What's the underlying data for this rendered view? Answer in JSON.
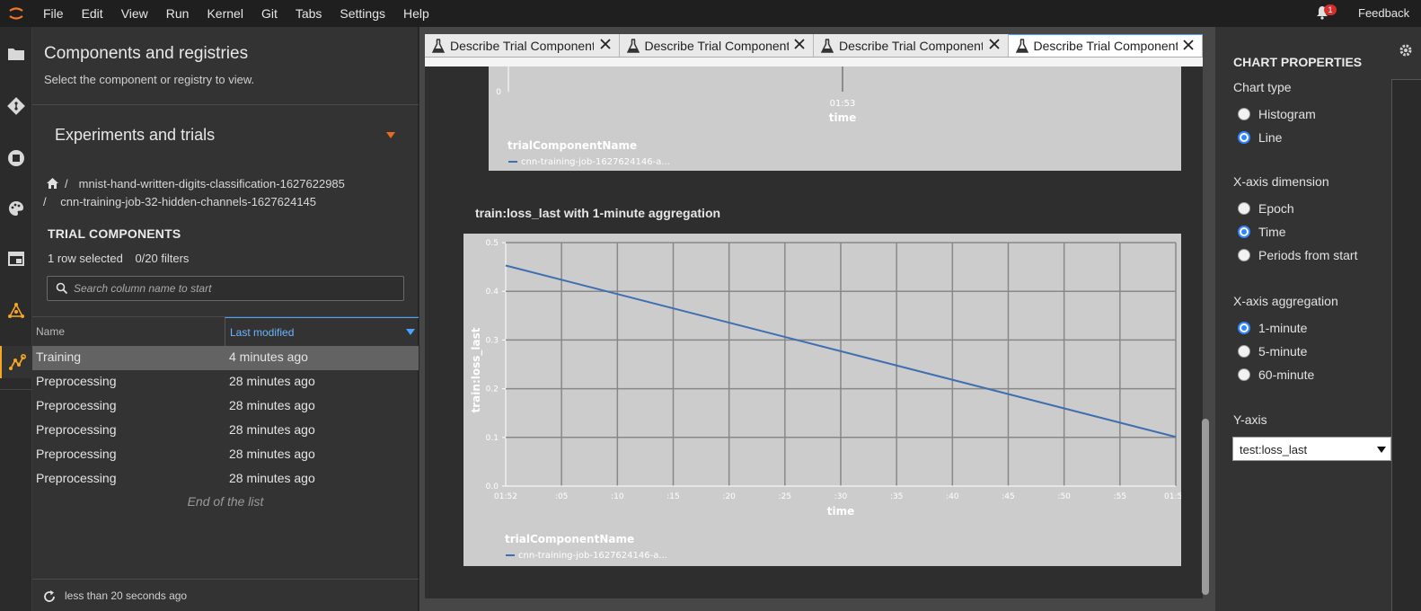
{
  "menubar": {
    "items": [
      "File",
      "Edit",
      "View",
      "Run",
      "Kernel",
      "Git",
      "Tabs",
      "Settings",
      "Help"
    ],
    "notification_count": "1",
    "feedback_label": "Feedback"
  },
  "left_panel": {
    "title": "Components and registries",
    "subtitle": "Select the component or registry to view.",
    "section_title": "Experiments and trials",
    "breadcrumb": {
      "experiment": "mnist-hand-written-digits-classification-1627622985",
      "trial": "cnn-training-job-32-hidden-channels-1627624145"
    },
    "trial_components_title": "TRIAL COMPONENTS",
    "selection_info": "1 row selected",
    "filter_info": "0/20 filters",
    "search_placeholder": "Search column name to start",
    "columns": [
      "Name",
      "Last modified"
    ],
    "rows": [
      {
        "name": "Training",
        "modified": "4 minutes ago",
        "selected": true
      },
      {
        "name": "Preprocessing",
        "modified": "28 minutes ago",
        "selected": false
      },
      {
        "name": "Preprocessing",
        "modified": "28 minutes ago",
        "selected": false
      },
      {
        "name": "Preprocessing",
        "modified": "28 minutes ago",
        "selected": false
      },
      {
        "name": "Preprocessing",
        "modified": "28 minutes ago",
        "selected": false
      },
      {
        "name": "Preprocessing",
        "modified": "28 minutes ago",
        "selected": false
      }
    ],
    "end_of_list": "End of the list",
    "footer_status": "less than 20 seconds ago"
  },
  "tabs": [
    {
      "label": "Describe Trial Component",
      "active": false
    },
    {
      "label": "Describe Trial Component",
      "active": false
    },
    {
      "label": "Describe Trial Component",
      "active": false
    },
    {
      "label": "Describe Trial Component",
      "active": true
    }
  ],
  "top_chart": {
    "y_tick": "0",
    "x_tick": "01:53",
    "x_label": "time",
    "legend_title": "trialComponentName",
    "legend_entry": "cnn-training-job-1627624146-a..."
  },
  "chart_title": "train:loss_last with 1-minute aggregation",
  "chart_data": {
    "type": "line",
    "title": "train:loss_last with 1-minute aggregation",
    "xlabel": "time",
    "ylabel": "train:loss_last",
    "x_ticks": [
      "01:52",
      ":05",
      ":10",
      ":15",
      ":20",
      ":25",
      ":30",
      ":35",
      ":40",
      ":45",
      ":50",
      ":55",
      "01:53"
    ],
    "y_ticks": [
      "0.0",
      "0.1",
      "0.2",
      "0.3",
      "0.4",
      "0.5"
    ],
    "ylim": [
      0,
      0.5
    ],
    "xlim_seconds": [
      0,
      60
    ],
    "grid": true,
    "legend_title": "trialComponentName",
    "legend_placement": "bottom-left",
    "series": [
      {
        "name": "cnn-training-job-1627624146-a...",
        "color": "#3f6fb0",
        "x": [
          0,
          60
        ],
        "y": [
          0.453,
          0.101
        ]
      }
    ]
  },
  "properties": {
    "title": "CHART PROPERTIES",
    "chart_type_label": "Chart type",
    "chart_types": [
      "Histogram",
      "Line"
    ],
    "chart_type_selected": "Line",
    "x_dim_label": "X-axis dimension",
    "x_dims": [
      "Epoch",
      "Time",
      "Periods from start"
    ],
    "x_dim_selected": "Time",
    "x_agg_label": "X-axis aggregation",
    "x_aggs": [
      "1-minute",
      "5-minute",
      "60-minute"
    ],
    "x_agg_selected": "1-minute",
    "y_axis_label": "Y-axis",
    "y_axis_value": "test:loss_last"
  },
  "colors": {
    "accent": "#f5a623",
    "selection_blue": "#2f86ff",
    "series_line": "#3f6fb0",
    "chart_bg": "#cccccc"
  }
}
